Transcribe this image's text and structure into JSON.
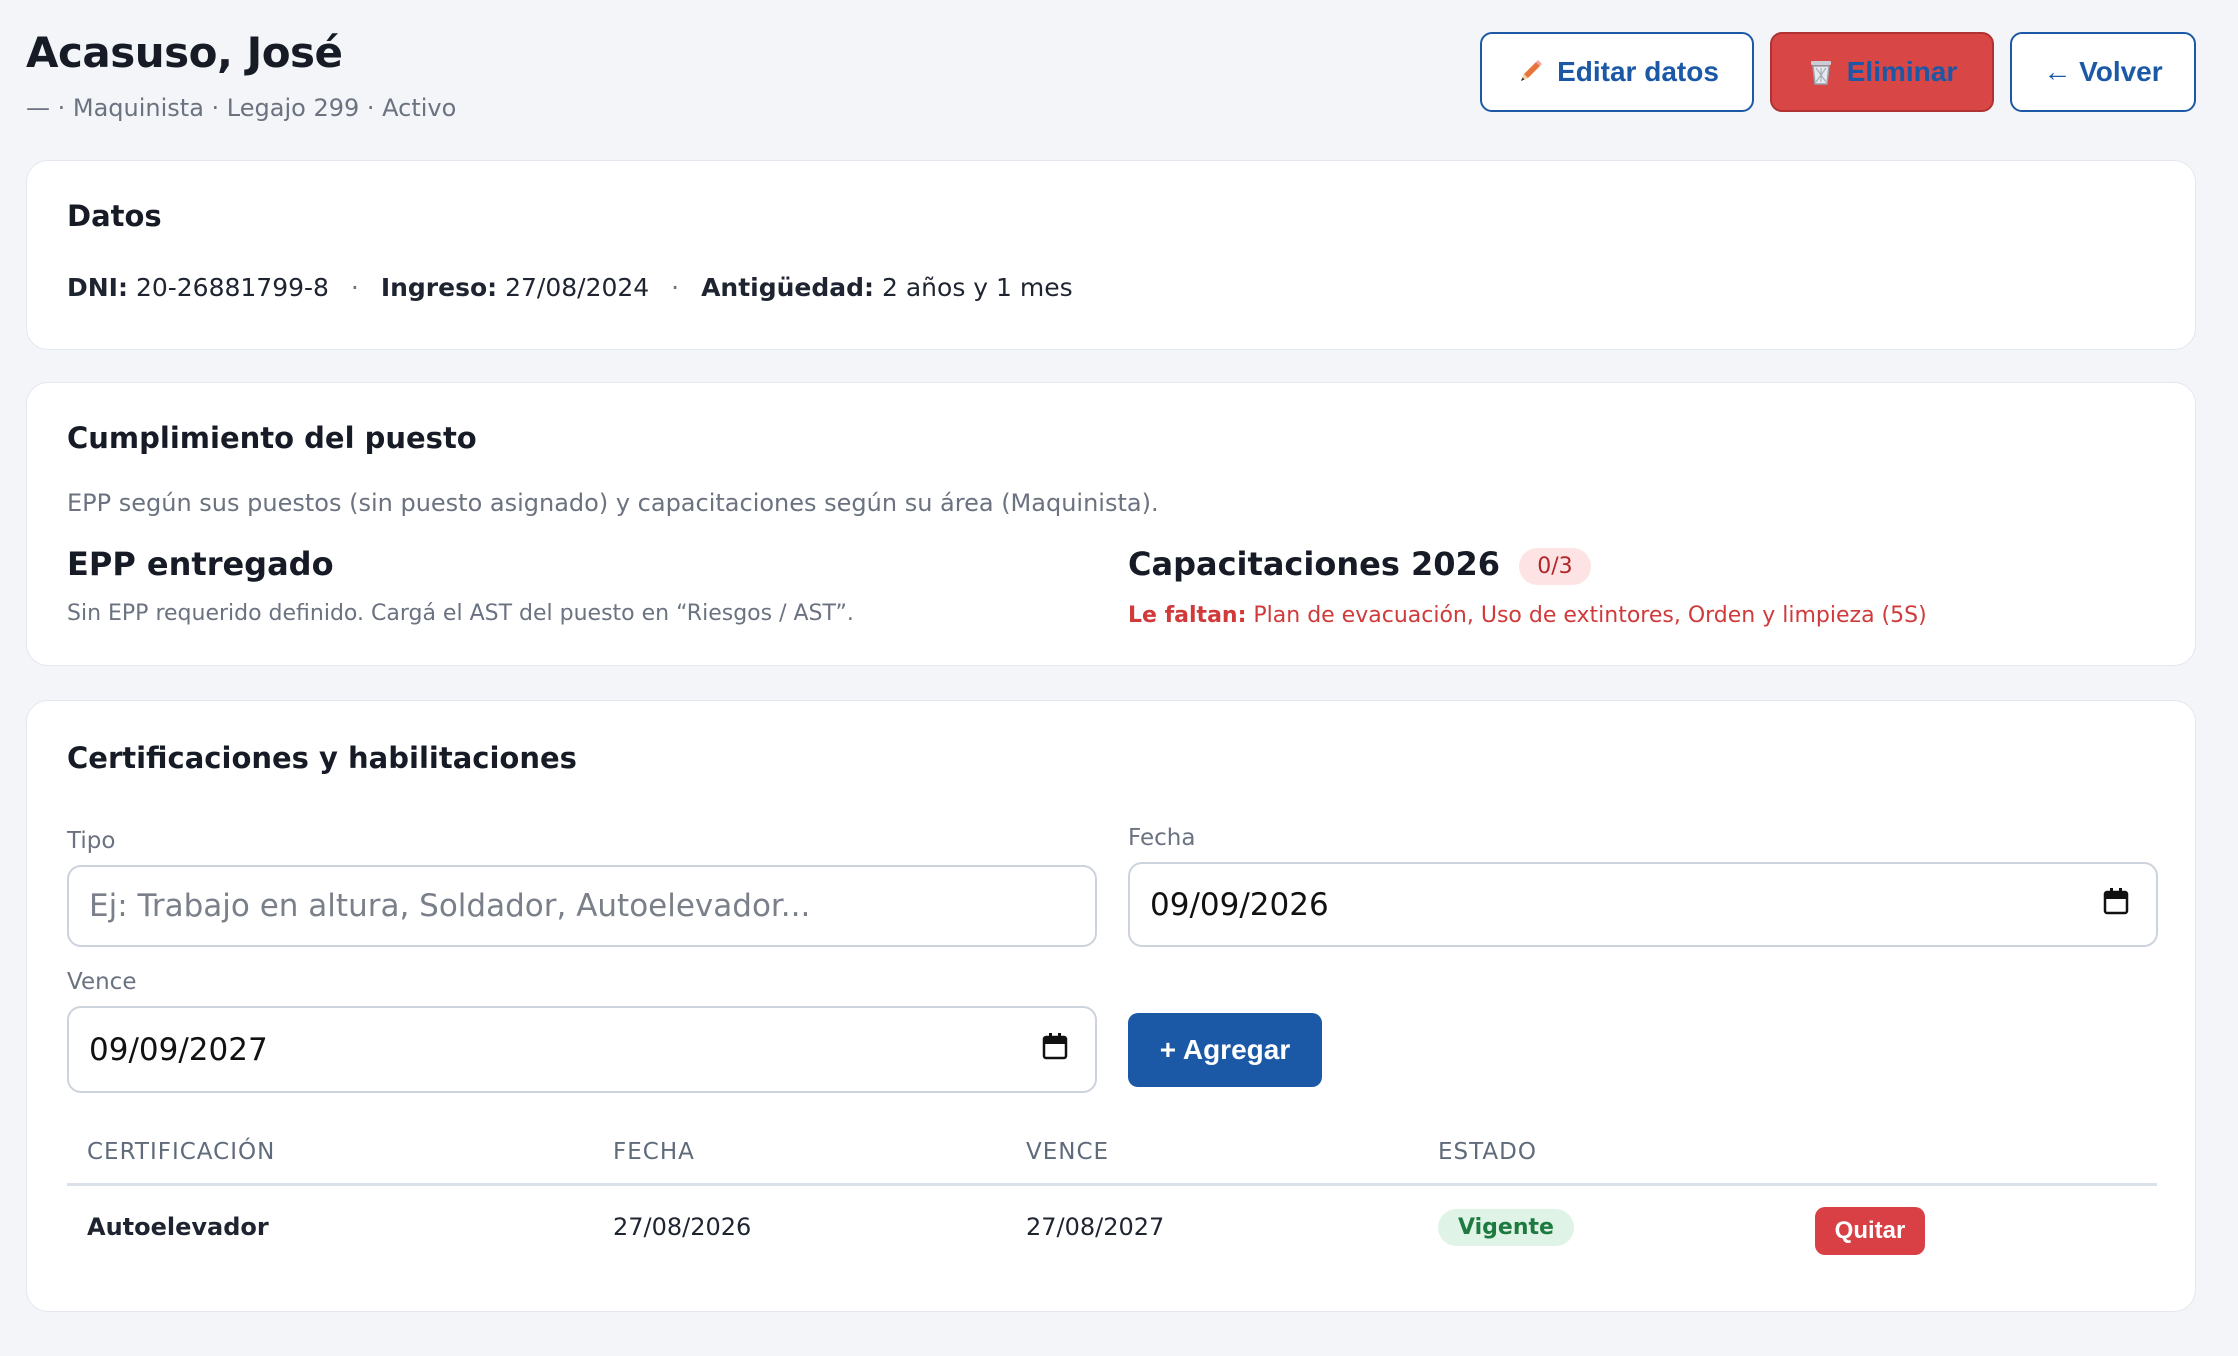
{
  "header": {
    "title": "Acasuso, José",
    "subtitle": "— · Maquinista · Legajo 299 · Activo",
    "edit_label": "Editar datos",
    "delete_label": "Eliminar",
    "back_label": "← Volver",
    "icons": {
      "edit": "pencil-icon",
      "delete": "wastebasket-icon"
    }
  },
  "datos": {
    "heading": "Datos",
    "dni_label": "DNI:",
    "dni_value": "20-26881799-8",
    "ingreso_label": "Ingreso:",
    "ingreso_value": "27/08/2024",
    "antiguedad_label": "Antigüedad:",
    "antiguedad_value": "2 años y 1 mes"
  },
  "cumplimiento": {
    "heading": "Cumplimiento del puesto",
    "description": "EPP según sus puestos (sin puesto asignado) y capacitaciones según su área (Maquinista).",
    "epp_heading": "EPP entregado",
    "epp_note": "Sin EPP requerido definido. Cargá el AST del puesto en “Riesgos / AST”.",
    "cap_heading": "Capacitaciones 2026",
    "cap_badge": "0/3",
    "missing_label": "Le faltan:",
    "missing_items": "Plan de evacuación, Uso de extintores, Orden y limpieza (5S)"
  },
  "certificaciones": {
    "heading": "Certificaciones y habilitaciones",
    "form": {
      "tipo_label": "Tipo",
      "tipo_placeholder": "Ej: Trabajo en altura, Soldador, Autoelevador...",
      "fecha_label": "Fecha",
      "fecha_value": "09/09/2026",
      "vence_label": "Vence",
      "vence_value": "09/09/2027",
      "add_label": "+ Agregar"
    },
    "columns": [
      "CERTIFICACIÓN",
      "FECHA",
      "VENCE",
      "ESTADO"
    ],
    "rows": [
      {
        "certificacion": "Autoelevador",
        "fecha": "27/08/2026",
        "vence": "27/08/2027",
        "estado": "Vigente",
        "action": "Quitar"
      }
    ]
  },
  "colors": {
    "primary": "#1b59a6",
    "danger": "#d94646",
    "success_bg": "#dff3e6",
    "success_text": "#1f7a3f",
    "missing_text": "#d03a3a"
  }
}
